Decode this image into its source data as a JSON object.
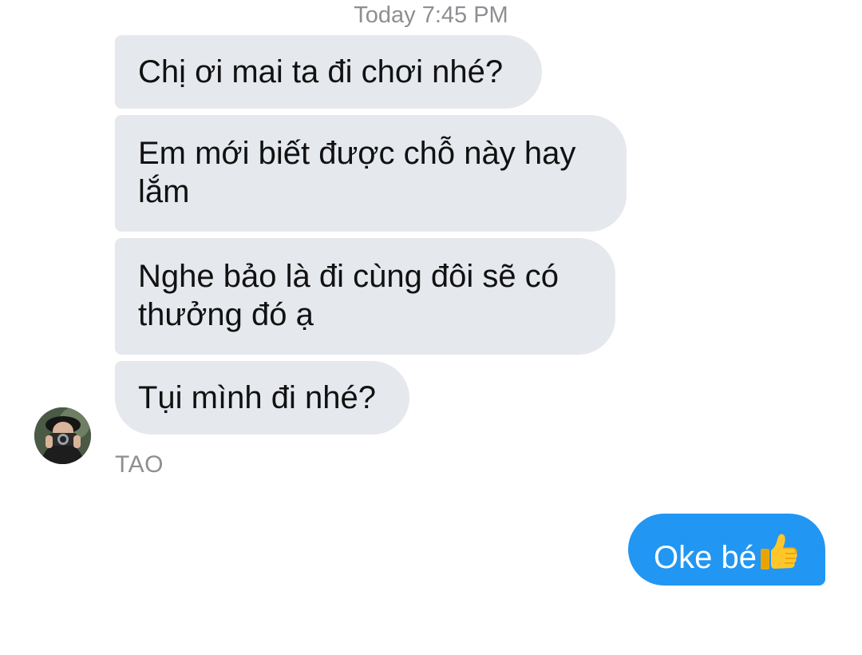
{
  "conversation": {
    "timestamp": "Today 7:45 PM",
    "incoming_messages": [
      {
        "text": "Chị ơi mai ta đi chơi nhé?"
      },
      {
        "text": "Em mới biết được chỗ này hay lắm"
      },
      {
        "text": "Nghe bảo là đi cùng đôi sẽ có thưởng đó ạ"
      },
      {
        "text": "Tụi mình đi nhé?"
      }
    ],
    "sender_name": "TAO",
    "outgoing_message": {
      "text": "Oke bé",
      "emoji_icon": "thumbs-up-icon"
    }
  },
  "colors": {
    "incoming_bubble": "#e5e8ed",
    "outgoing_bubble": "#2196f3",
    "meta_text": "#8e8e93"
  }
}
